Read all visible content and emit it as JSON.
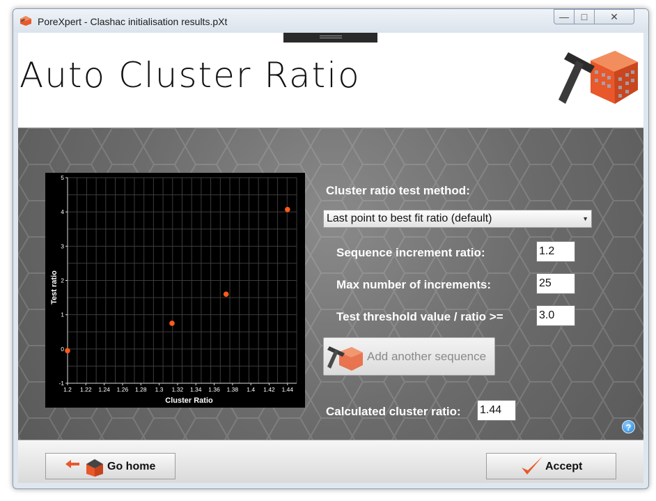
{
  "window": {
    "title": "PoreXpert - Clashac initialisation results.pXt"
  },
  "header": {
    "title": "Auto Cluster Ratio"
  },
  "form": {
    "method_label": "Cluster ratio test method:",
    "method_selected": "Last point to best fit ratio (default)",
    "seq_increment_label": "Sequence increment ratio:",
    "seq_increment_value": "1.2",
    "max_increments_label": "Max number of increments:",
    "max_increments_value": "25",
    "threshold_label": "Test threshold value / ratio >=",
    "threshold_value": "3.0",
    "add_sequence_label": "Add another sequence",
    "calc_ratio_label": "Calculated cluster ratio:",
    "calc_ratio_value": "1.44"
  },
  "footer": {
    "home_label": "Go home",
    "accept_label": "Accept"
  },
  "colors": {
    "accent": "#e8582a",
    "point": "#ff5a1a"
  },
  "chart_data": {
    "type": "scatter",
    "xlabel": "Cluster Ratio",
    "ylabel": "Test ratio",
    "xlim": [
      1.2,
      1.45
    ],
    "ylim": [
      -1,
      5
    ],
    "xticks": [
      "1.2",
      "1.22",
      "1.24",
      "1.26",
      "1.28",
      "1.3",
      "1.32",
      "1.34",
      "1.36",
      "1.38",
      "1.4",
      "1.42",
      "1.44"
    ],
    "yticks": [
      "-1",
      "0",
      "1",
      "2",
      "3",
      "4",
      "5"
    ],
    "grid": true,
    "points": [
      {
        "x": 1.2,
        "y": -0.05
      },
      {
        "x": 1.314,
        "y": 0.75
      },
      {
        "x": 1.373,
        "y": 1.6
      },
      {
        "x": 1.44,
        "y": 4.07
      }
    ]
  }
}
